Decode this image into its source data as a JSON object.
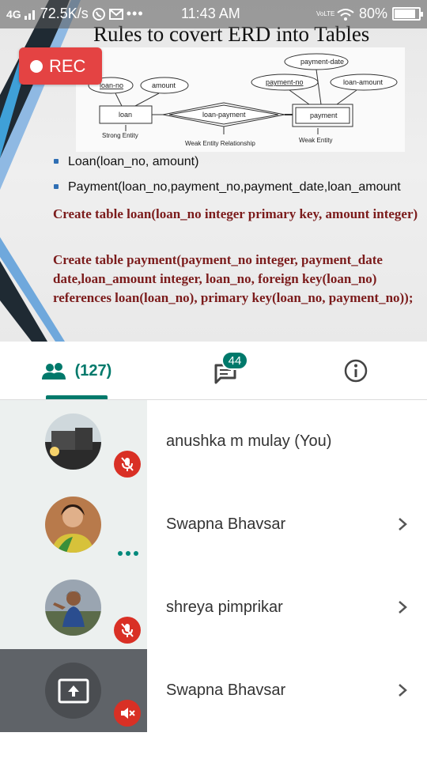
{
  "status_bar": {
    "network": "4G",
    "speed": "72.5K/s",
    "time": "11:43 AM",
    "volte": "VoLTE",
    "battery": "80%"
  },
  "slide": {
    "title": "Rules to covert ERD into Tables",
    "diagram": {
      "entities": [
        "loan",
        "payment"
      ],
      "relationship": "loan-payment",
      "attributes_loan": [
        "loan-no",
        "amount"
      ],
      "attributes_payment": [
        "payment-date",
        "payment-no",
        "loan-amount"
      ],
      "captions": [
        "Strong Entity",
        "Weak Entity Relationship",
        "Weak Entity"
      ]
    },
    "bullets": [
      "Loan(loan_no, amount)",
      "Payment(loan_no,payment_no,payment_date,loan_amount"
    ],
    "sql_1": "Create table loan(loan_no integer primary key, amount integer)",
    "sql_2": "Create table payment(payment_no integer, payment_date date,loan_amount integer, loan_no, foreign key(loan_no) references loan(loan_no), primary key(loan_no, payment_no));"
  },
  "rec_label": "REC",
  "tabs": {
    "people_count": "(127)",
    "chat_badge": "44",
    "accent": "#00796b"
  },
  "participants": [
    {
      "name": "anushka m mulay (You)",
      "status": "muted"
    },
    {
      "name": "Swapna Bhavsar",
      "status": "speaking"
    },
    {
      "name": "shreya pimprikar",
      "status": "muted"
    },
    {
      "name": "Swapna Bhavsar",
      "status": "presenting"
    }
  ],
  "colors": {
    "mute_red": "#d93025",
    "sql_text": "#7b1b1b",
    "rec_red": "#e44343"
  }
}
